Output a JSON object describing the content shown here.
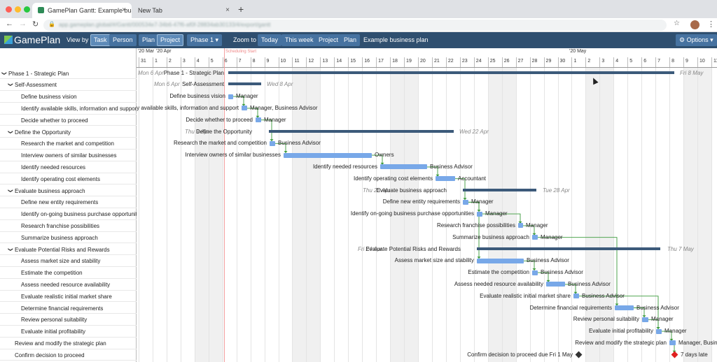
{
  "browser": {
    "tabs": [
      {
        "label": "GamePlan Gantt: Example busi",
        "close": "×"
      },
      {
        "label": "New Tab",
        "close": "×"
      }
    ],
    "new_tab": "+",
    "url": "app.gameplan.global/#/Gantt/000534e7-34b6-47f6-af0f-28834ab30133/4/export/gantt"
  },
  "appbar": {
    "logo": "GamePlan",
    "view_by_label": "View by",
    "task": "Task",
    "person": "Person",
    "plan": "Plan",
    "project": "Project",
    "phase_select": "Phase 1 ▾",
    "zoom_to_label": "Zoom to",
    "today": "Today",
    "this_week": "This week",
    "zoom_project": "Project",
    "zoom_plan": "Plan",
    "plan_name": "Example business plan",
    "options": "⚙ Options ▾"
  },
  "colors": {
    "accent": "#2f4f6f",
    "bar": "#78a8e8",
    "summary": "#3c5a7a",
    "link": "#3a9a3a",
    "overdue": "#e02020"
  },
  "task_list": [
    {
      "label": "Phase 1 - Strategic Plan",
      "level": 0,
      "group": true
    },
    {
      "label": "Self-Assessment",
      "level": 1,
      "group": true
    },
    {
      "label": "Define business vision",
      "level": 2
    },
    {
      "label": "Identify available skills, information and support",
      "level": 2
    },
    {
      "label": "Decide whether to proceed",
      "level": 2
    },
    {
      "label": "Define the Opportunity",
      "level": 1,
      "group": true
    },
    {
      "label": "Research the market and competition",
      "level": 2
    },
    {
      "label": "Interview owners of similar businesses",
      "level": 2
    },
    {
      "label": "Identify needed resources",
      "level": 2
    },
    {
      "label": "Identify operating cost elements",
      "level": 2
    },
    {
      "label": "Evaluate business approach",
      "level": 1,
      "group": true
    },
    {
      "label": "Define new entity requirements",
      "level": 2
    },
    {
      "label": "Identify on-going business purchase opportunities",
      "level": 2
    },
    {
      "label": "Research franchise possibilities",
      "level": 2
    },
    {
      "label": "Summarize business approach",
      "level": 2
    },
    {
      "label": "Evaluate Potential Risks and Rewards",
      "level": 1,
      "group": true
    },
    {
      "label": "Assess market size and stability",
      "level": 2
    },
    {
      "label": "Estimate the competition",
      "level": 2
    },
    {
      "label": "Assess needed resource availability",
      "level": 2
    },
    {
      "label": "Evaluate realistic initial market share",
      "level": 2
    },
    {
      "label": "Determine financial requirements",
      "level": 2
    },
    {
      "label": "Review personal suitability",
      "level": 2
    },
    {
      "label": "Evaluate initial profitability",
      "level": 2
    },
    {
      "label": "Review and modify the strategic plan",
      "level": 1
    },
    {
      "label": "Confirm decision to proceed",
      "level": 1
    }
  ],
  "timeline": {
    "months": [
      "'20  Mar",
      "'20  Apr",
      "'20  May"
    ],
    "scheduling_start": "Scheduling Start",
    "days": [
      "31",
      "1",
      "2",
      "3",
      "4",
      "5",
      "6",
      "7",
      "8",
      "9",
      "10",
      "11",
      "12",
      "13",
      "14",
      "15",
      "16",
      "17",
      "18",
      "19",
      "20",
      "21",
      "22",
      "23",
      "24",
      "25",
      "26",
      "27",
      "28",
      "29",
      "30",
      "1",
      "2",
      "3",
      "4",
      "5",
      "6",
      "7",
      "8",
      "9",
      "10",
      "11"
    ]
  },
  "gantt": {
    "summaries": [
      {
        "row": 0,
        "start": "Mon 6 Apr",
        "name": "Phase 1 - Strategic Plan",
        "end": "Fri 8 May"
      },
      {
        "row": 1,
        "start": "Mon 6 Apr",
        "name": "Self-Assessment",
        "end": "Wed 8 Apr"
      },
      {
        "row": 5,
        "start": "Thu 9 Apr",
        "name": "Define the Opportunity",
        "end": "Wed 22 Apr"
      },
      {
        "row": 10,
        "start": "Thu 23 Apr",
        "name": "Evaluate business approach",
        "end": "Tue 28 Apr"
      },
      {
        "row": 15,
        "start": "Fri 24 Apr",
        "name": "Evaluate Potential Risks and Rewards",
        "end": "Thu 7 May"
      }
    ],
    "tasks": [
      {
        "row": 2,
        "name": "Define business vision",
        "res": "Manager"
      },
      {
        "row": 3,
        "name": "Identify available skills, information and support",
        "res": "Manager, Business Advisor"
      },
      {
        "row": 4,
        "name": "Decide whether to proceed",
        "res": "Manager"
      },
      {
        "row": 6,
        "name": "Research the market and competition",
        "res": "Business Advisor"
      },
      {
        "row": 7,
        "name": "Interview owners of similar businesses",
        "res": "Owners"
      },
      {
        "row": 8,
        "name": "Identify needed resources",
        "res": "Business Advisor"
      },
      {
        "row": 9,
        "name": "Identify operating cost elements",
        "res": "Accountant"
      },
      {
        "row": 11,
        "name": "Define new entity requirements",
        "res": "Manager"
      },
      {
        "row": 12,
        "name": "Identify on-going business purchase opportunities",
        "res": "Manager"
      },
      {
        "row": 13,
        "name": "Research franchise possibilities",
        "res": "Manager"
      },
      {
        "row": 14,
        "name": "Summarize business approach",
        "res": "Manager"
      },
      {
        "row": 16,
        "name": "Assess market size and stability",
        "res": "Business Advisor"
      },
      {
        "row": 17,
        "name": "Estimate the competition",
        "res": "Business Advisor"
      },
      {
        "row": 18,
        "name": "Assess needed resource availability",
        "res": "Business Advisor"
      },
      {
        "row": 19,
        "name": "Evaluate realistic initial market share",
        "res": "Business Advisor"
      },
      {
        "row": 20,
        "name": "Determine financial requirements",
        "res": "Business Advisor"
      },
      {
        "row": 21,
        "name": "Review personal suitability",
        "res": "Manager"
      },
      {
        "row": 22,
        "name": "Evaluate initial profitability",
        "res": "Manager"
      },
      {
        "row": 23,
        "name": "Review and modify the strategic plan",
        "res": "Manager, Busin"
      }
    ],
    "milestones": [
      {
        "row": 24,
        "name": "Confirm decision to proceed due Fri 1 May"
      },
      {
        "row": 24,
        "name": "7 days late"
      }
    ]
  }
}
